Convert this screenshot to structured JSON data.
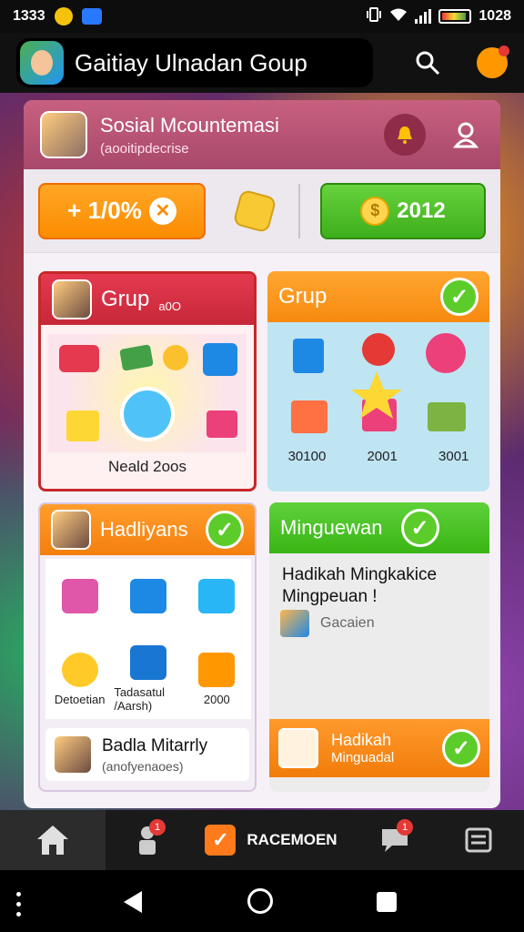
{
  "status_bar": {
    "time": "1333",
    "clock_right": "1028"
  },
  "header": {
    "title": "Gaitiay Ulnadan Goup"
  },
  "profile": {
    "name": "Sosial Mcountemasi",
    "subtitle": "(aooitipdecrise"
  },
  "actions": {
    "orange_button": "+ 1/0%",
    "green_button": "2012"
  },
  "cards": {
    "card1": {
      "title": "Grup",
      "suffix": "a0O",
      "footer": "Neald 2oos"
    },
    "card2": {
      "title": "Grup",
      "labels": [
        "30100",
        "2001",
        "3001"
      ]
    },
    "card3": {
      "title": "Hadliyans",
      "items": [
        "",
        "",
        "",
        "Detoetian",
        "Tadasatul /Aarsh)",
        "2000"
      ],
      "bottom_title": "Badla Mitarrly",
      "bottom_sub": "(anofyenaoes)"
    },
    "card4": {
      "title": "Minguewan",
      "body": "Hadikah Mingkakice Mingpeuan !",
      "meta": "Gacaien",
      "bar_title": "Hadikah",
      "bar_sub": "Minguadal"
    }
  },
  "bottom_nav": {
    "badge1": "1",
    "main_label": "RACEMOEN",
    "badge2": "1"
  },
  "colors": {
    "header_pink": "#c86080",
    "orange": "#fb8c00",
    "green": "#3fae1c",
    "red": "#c62828"
  }
}
